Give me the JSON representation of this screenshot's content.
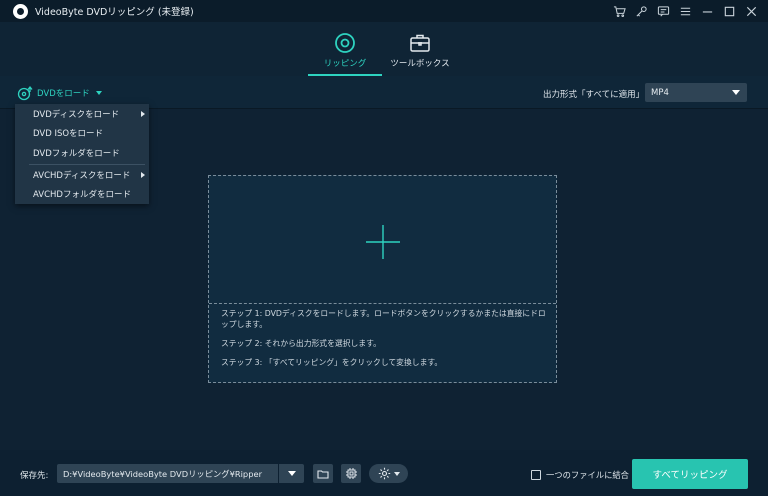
{
  "window": {
    "title": "VideoByte DVDリッピング (未登録)",
    "icons": [
      "cart-icon",
      "key-icon",
      "feedback-icon",
      "menu-icon",
      "minimize-icon",
      "maximize-icon",
      "close-icon"
    ]
  },
  "tabs": [
    {
      "label": "リッピング",
      "icon": "disc-icon",
      "active": true
    },
    {
      "label": "ツールボックス",
      "icon": "toolbox-icon",
      "active": false
    }
  ],
  "toolbar": {
    "load_dvd_label": "DVDをロード",
    "format_label": "出力形式「すべてに適用」:",
    "format_value": "MP4"
  },
  "load_menu": {
    "items": [
      {
        "label": "DVDディスクをロード",
        "submenu": true
      },
      {
        "label": "DVD ISOをロード",
        "submenu": false
      },
      {
        "label": "DVDフォルダをロード",
        "submenu": false
      },
      {
        "label": "AVCHDディスクをロード",
        "submenu": true
      },
      {
        "label": "AVCHDフォルダをロード",
        "submenu": false
      }
    ]
  },
  "drop_zone": {
    "steps": [
      "ステップ 1: DVDディスクをロードします。ロードボタンをクリックするかまたは直接にドロップします。",
      "ステップ 2: それから出力形式を選択します。",
      "ステップ 3: 「すべてリッピング」をクリックして変換します。"
    ]
  },
  "bottom": {
    "save_label": "保存先:",
    "save_path": "D:¥VideoByte¥VideoByte DVDリッピング¥Ripper",
    "merge_label": "一つのファイルに結合",
    "merge_checked": false,
    "rip_all_label": "すべてリッピング"
  },
  "colors": {
    "accent": "#2ed3c0",
    "button": "#28c4b0",
    "background": "#0f2233"
  }
}
